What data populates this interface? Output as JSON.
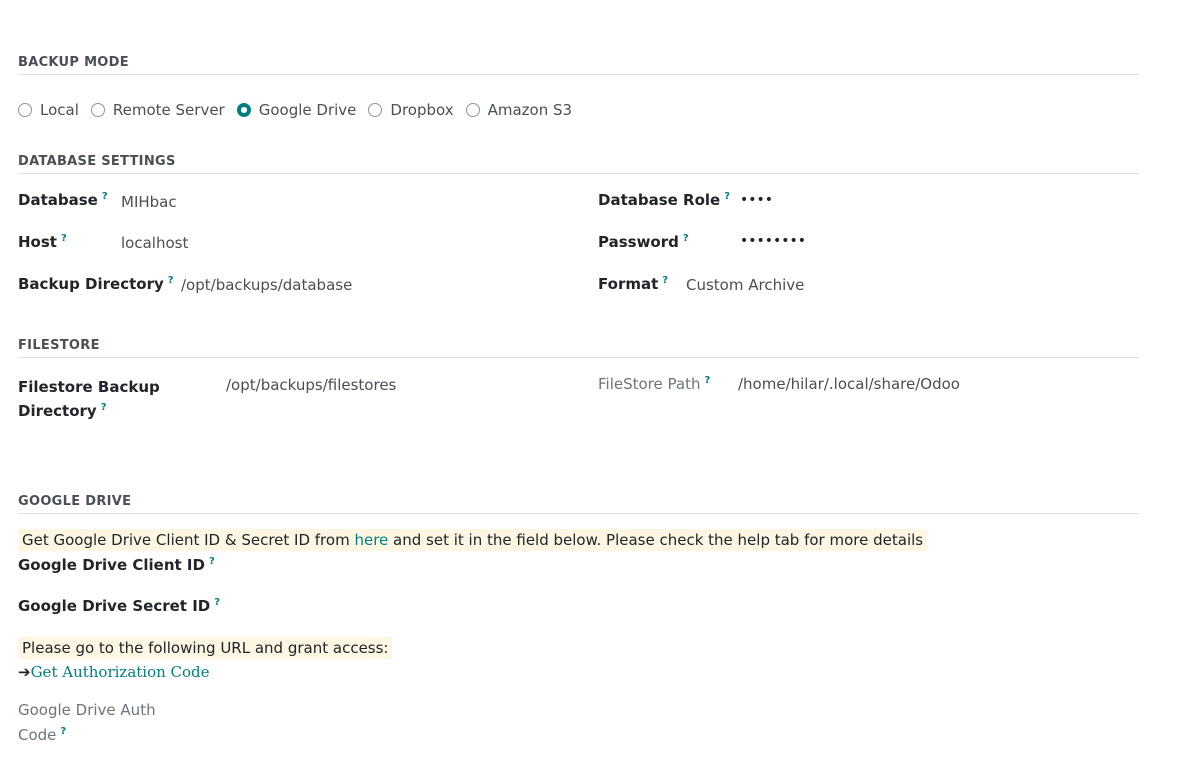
{
  "sections": {
    "backup_mode": "BACKUP MODE",
    "database_settings": "DATABASE SETTINGS",
    "filestore": "FILESTORE",
    "google_drive": "GOOGLE DRIVE"
  },
  "backup_mode": {
    "options": [
      "Local",
      "Remote Server",
      "Google Drive",
      "Dropbox",
      "Amazon S3"
    ],
    "selected": "Google Drive"
  },
  "database": {
    "database_label": "Database",
    "database_value": "MIHbac",
    "host_label": "Host",
    "host_value": "localhost",
    "backup_dir_label": "Backup Directory",
    "backup_dir_value": "/opt/backups/database",
    "role_label": "Database Role",
    "role_value": "••••",
    "password_label": "Password",
    "password_value": "••••••••",
    "format_label": "Format",
    "format_value": "Custom Archive"
  },
  "filestore": {
    "backup_dir_label_line1": "Filestore Backup",
    "backup_dir_label_line2": "Directory",
    "backup_dir_value": "/opt/backups/filestores",
    "path_label": "FileStore Path",
    "path_value": "/home/hilar/.local/share/Odoo"
  },
  "google_drive": {
    "notice_prefix": "Get Google Drive Client ID & Secret ID from ",
    "notice_link": "here",
    "notice_suffix": " and set it in the field below. Please check the help tab for more details",
    "client_id_label": "Google Drive Client ID",
    "secret_id_label": "Google Drive Secret ID",
    "grant_notice": "Please go to the following URL and grant access:",
    "auth_link_arrow": "➔",
    "auth_link": "Get Authorization Code",
    "auth_code_label_line1": "Google Drive Auth",
    "auth_code_label_line2": "Code"
  },
  "help_mark": "?",
  "colors": {
    "accent": "#017e84",
    "notice_bg": "#fcf6e3",
    "muted": "#6c757d"
  }
}
